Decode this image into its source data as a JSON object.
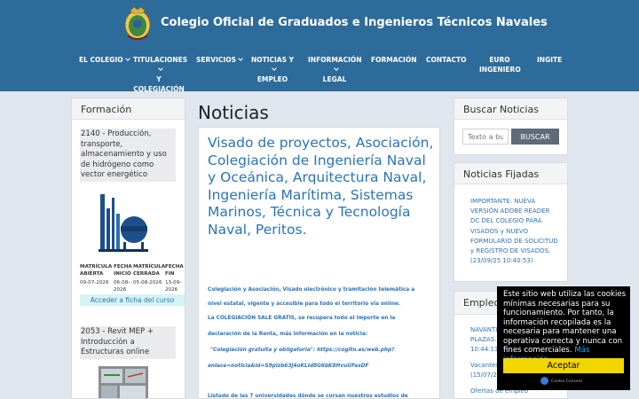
{
  "header": {
    "title": "Colegio Oficial de Graduados e Ingenieros Técnicos Navales",
    "logo_icon": "crest-logo",
    "bg_color": "#2d6b9b"
  },
  "nav": [
    {
      "line1": "EL COLEGIO",
      "line2": "",
      "line3": "",
      "dropdown": true
    },
    {
      "line1": "TITULACIONES",
      "line2": "Y",
      "line3": "COLEGIACIÓN",
      "dropdown": true
    },
    {
      "line1": "SERVICIOS",
      "line2": "",
      "line3": "",
      "dropdown": true
    },
    {
      "line1": "NOTICIAS Y",
      "line2": "EMPLEO",
      "line3": "",
      "dropdown": true
    },
    {
      "line1": "INFORMACIÓN",
      "line2": "LEGAL",
      "line3": "",
      "dropdown": true
    },
    {
      "line1": "FORMACIÓN",
      "line2": "",
      "line3": "",
      "dropdown": false
    },
    {
      "line1": "CONTACTO",
      "line2": "",
      "line3": "",
      "dropdown": false
    },
    {
      "line1": "EURO",
      "line2": "INGENIERO",
      "line3": "",
      "dropdown": false
    },
    {
      "line1": "INGITE",
      "line2": "",
      "line3": "",
      "dropdown": false
    }
  ],
  "formacion": {
    "heading": "Formación",
    "course1": {
      "title": "2140 - Producción, transporte, almacenamiento y uso de hidrógeno como vector energético",
      "columns": [
        {
          "head1": "MATRÍCULA",
          "head2": "ABIERTA",
          "value1": "09-07-2026",
          "value2": ""
        },
        {
          "head1": "FECHA",
          "head2": "INICIO",
          "value1": "06-08-",
          "value2": "2026"
        },
        {
          "head1": "MATRÍCULA",
          "head2": "CERRADA",
          "value1": "05-08-2026",
          "value2": ""
        },
        {
          "head1": "FECHA",
          "head2": "FIN",
          "value1": "13-09-",
          "value2": "2026"
        }
      ],
      "link": "Acceder a ficha del curso"
    },
    "course2": {
      "title": "2053 - Revit MEP + Introducción a Estructuras online"
    }
  },
  "main": {
    "page_title": "Noticias",
    "article_title": "Visado de proyectos, Asociación, Colegiación de Ingeniería Naval y Oceánica, Arquitectura Naval, Ingeniería Marítima, Sistemas Marinos, Técnica y Tecnología Naval, Peritos.",
    "body_lines": [
      "Colegiación y Asociación, Visado electrónico y tramitación telemática a",
      "nivel estatal, vigente y accesible para todo el territorio vía online.",
      "La COLEGIACIÓN SALE GRATIS, se recupera todo el importe en la",
      "declaración de la Renta, más información en la noticia:",
      "\"Colegiación gratuita y obligatoria\": https://cogitn.es/web.php?",
      "enlace=noticia&id=S9pizb63J4oKLId8G6bK8HvuUFasDF",
      "Listado de las 7 universidades dónde se cursan nuestros estudios de"
    ]
  },
  "search": {
    "heading": "Buscar Noticias",
    "placeholder": "Texto a buscar",
    "button": "BUSCAR"
  },
  "fixed_news": {
    "heading": "Noticias Fijadas",
    "item": "IMPORTANTE: NUEVA VERSIÓN ADOBE READER DC DEL COLEGIO PARA VISADOS y NUEVO FORMULARIO DE SOLICITUD y REGISTRO DE VISADOS. (23/09/25 10:40:53)"
  },
  "empleo": {
    "heading": "Empleo",
    "items": [
      "NAVANTIA",
      "PLAZAS.",
      "10:44:13",
      "Vacantes",
      "(15/07/2",
      "Ofertas de empleo"
    ]
  },
  "cookie": {
    "text": "Este sitio web utiliza las cookies mínimas necesarias para su funcionamiento. Por tanto, la información recopilada es la necesaria para mantener una operativa correcta y nunca con fines comerciales.",
    "link": "Más información",
    "accept": "Aceptar",
    "badge": "Cookie Consent"
  }
}
